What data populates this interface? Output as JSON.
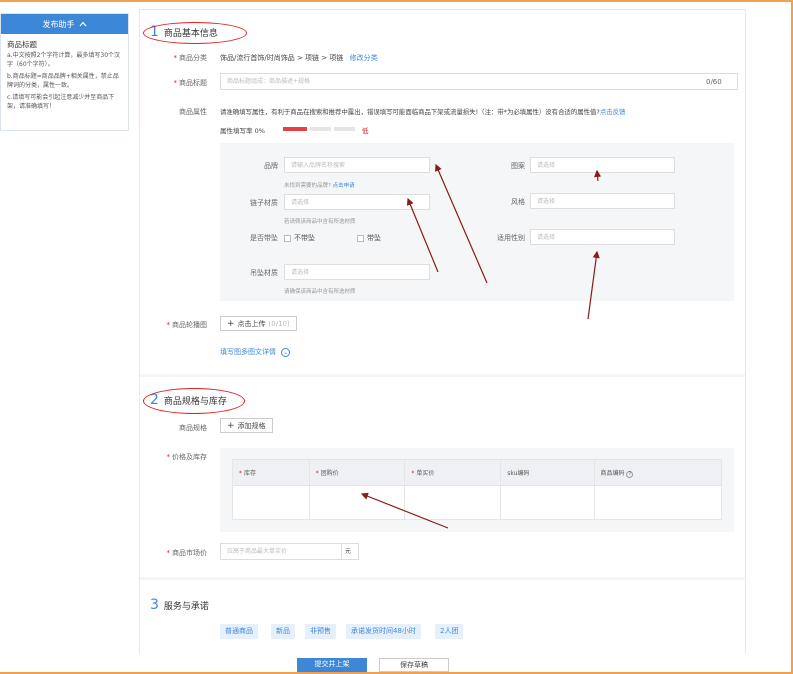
{
  "helper": {
    "title": "发布助手",
    "heading": "商品标题",
    "tips": [
      "a.中文按照2个字符计算，最多填写30个汉字（60个字符）。",
      "b.商品标题=商品品牌+相关属性，禁止品牌词的分类，属性一致。",
      "c.请填写可能会引起注意减少并至商品下架，请准确填写！"
    ]
  },
  "section1": {
    "num": "1",
    "title": "商品基本信息",
    "category_label": "商品分类",
    "category_value": "饰品/流行首饰/时尚饰品 > 项链 > 项链",
    "category_edit": "修改分类",
    "title_label": "商品标题",
    "title_placeholder": "商品标题组成：商品描述+规格",
    "title_count": "0/60",
    "attr_label": "商品属性",
    "attr_notice": "请准确填写属性，有利于商品在搜索和推荐中露出，错误填写可能面临商品下架或流量损失!（注：带*为必填属性）没有合适的属性值?",
    "attr_feedback": "点击反馈",
    "fill_rate_label": "属性填写率 0%",
    "fill_rate_value": 0,
    "fill_rate_level": "低",
    "attrs": {
      "brand_label": "品牌",
      "brand_placeholder": "请输入品牌名称搜索",
      "brand_hint": "未找到需要的品牌?",
      "brand_hint_link": "点击申请",
      "chain_label": "链子材质",
      "chain_placeholder": "请选择",
      "chain_hint": "若请佩该商品中含有所选材质",
      "pendant_label": "是否带坠",
      "pendant_opt1": "不带坠",
      "pendant_opt2": "带坠",
      "pendant_mat_label": "吊坠材质",
      "pendant_mat_placeholder": "请选择",
      "pendant_mat_hint": "请确保该商品中含有所选材质",
      "pattern_label": "图案",
      "pattern_placeholder": "请选择",
      "style_label": "风格",
      "style_placeholder": "请选择",
      "gender_label": "适用性别",
      "gender_placeholder": "请选择"
    },
    "image_label": "商品轮播图",
    "upload_label": "点击上传",
    "upload_count": "(0/10)",
    "detail_link": "填写图多图文详情"
  },
  "section2": {
    "num": "2",
    "title": "商品规格与库存",
    "spec_label": "商品规格",
    "add_spec": "添加规格",
    "price_stock_label": "价格及库存",
    "columns": [
      "库存",
      "团购价",
      "单买价",
      "sku编码",
      "商品编码"
    ],
    "required_cols": [
      true,
      true,
      true,
      false,
      false
    ],
    "market_price_label": "商品市场价",
    "market_price_placeholder": "应高于商品最大单买价",
    "unit": "元"
  },
  "section3": {
    "num": "3",
    "title": "服务与承诺",
    "tags": [
      "普通商品",
      "新品",
      "非预售",
      "承诺发货时间48小时",
      "2人团"
    ]
  },
  "footer": {
    "submit": "提交并上架",
    "draft": "保存草稿"
  },
  "colors": {
    "accent": "#3d87d8",
    "required": "#e02020",
    "frame": "#f0a050",
    "arrow": "#8b1a1a"
  }
}
